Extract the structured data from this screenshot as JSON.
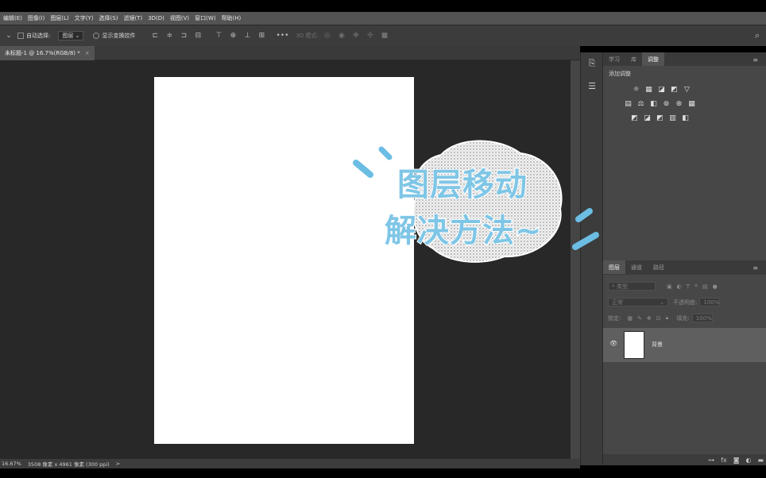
{
  "menu": [
    "编辑(E)",
    "图像(I)",
    "图层(L)",
    "文字(Y)",
    "选择(S)",
    "滤镜(T)",
    "3D(D)",
    "视图(V)",
    "窗口(W)",
    "帮助(H)"
  ],
  "options": {
    "auto_select_label": "自动选择:",
    "auto_select_value": "图层",
    "show_transform_label": "显示变换控件",
    "mode_3d_label": "3D 模式:"
  },
  "document": {
    "tab_title": "未标题-1 @ 16.7%(RGB/8) *",
    "tab_close": "×"
  },
  "adjust_panel": {
    "tabs": [
      "学习",
      "库",
      "调整"
    ],
    "active_tab": "调整",
    "title": "添加调整"
  },
  "layers_panel": {
    "tabs": [
      "图层",
      "通道",
      "路径"
    ],
    "filter_placeholder": "类型",
    "blend_mode": "正常",
    "opacity_label": "不透明度:",
    "opacity_value": "100%",
    "lock_label": "锁定:",
    "fill_label": "填充:",
    "fill_value": "100%",
    "layer_name": "背景"
  },
  "status": {
    "zoom": "16.67%",
    "doc_size": "3508 像素 x 4961 像素 (300 ppi)",
    "arrow": ">"
  },
  "overlay": {
    "line1": "图层移动",
    "line2": "解决方法~"
  },
  "colors": {
    "overlay_text": "#7fc6e6",
    "canvas_bg": "#282828",
    "panel_bg": "#474747"
  }
}
